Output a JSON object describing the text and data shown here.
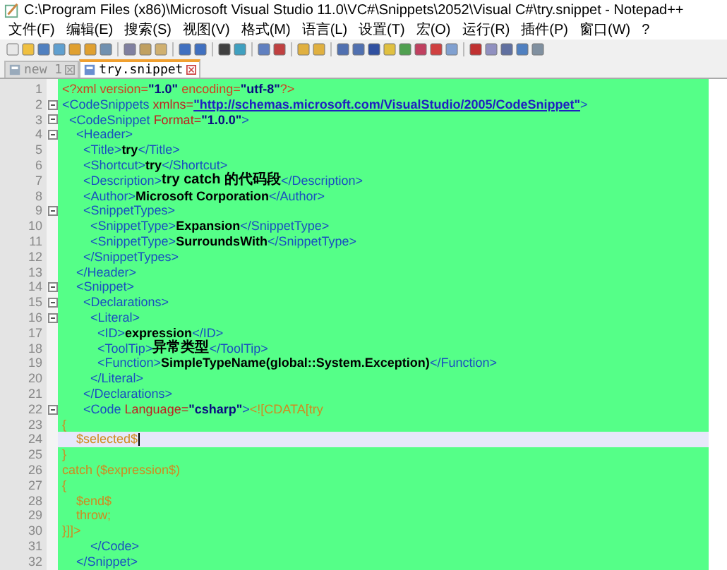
{
  "window": {
    "title": "C:\\Program Files (x86)\\Microsoft Visual Studio 11.0\\VC#\\Snippets\\2052\\Visual C#\\try.snippet - Notepad++"
  },
  "menu": [
    "文件(F)",
    "编辑(E)",
    "搜索(S)",
    "视图(V)",
    "格式(M)",
    "语言(L)",
    "设置(T)",
    "宏(O)",
    "运行(R)",
    "插件(P)",
    "窗口(W)",
    "?"
  ],
  "tabs": [
    {
      "label": "new 1",
      "selected": false
    },
    {
      "label": "try.snippet",
      "selected": true
    }
  ],
  "lines": [
    {
      "number": "1",
      "fold": false,
      "current": false,
      "tokens": [
        {
          "kind": "pi",
          "text": "<?xml version="
        },
        {
          "kind": "value",
          "text": "\"1.0\""
        },
        {
          "kind": "pi",
          "text": " encoding="
        },
        {
          "kind": "value",
          "text": "\"utf-8\""
        },
        {
          "kind": "pi",
          "text": "?>"
        }
      ]
    },
    {
      "number": "2",
      "fold": true,
      "current": false,
      "tokens": [
        {
          "kind": "tag",
          "text": "<CodeSnippets "
        },
        {
          "kind": "attr",
          "text": "xmlns="
        },
        {
          "kind": "link",
          "text": "\"http://schemas.microsoft.com/VisualStudio/2005/CodeSnippet\""
        },
        {
          "kind": "tag",
          "text": ">"
        }
      ]
    },
    {
      "number": "3",
      "fold": true,
      "current": false,
      "tokens": [
        {
          "kind": "tag",
          "text": "  <CodeSnippet "
        },
        {
          "kind": "attr",
          "text": "Format="
        },
        {
          "kind": "value",
          "text": "\"1.0.0\""
        },
        {
          "kind": "tag",
          "text": ">"
        }
      ]
    },
    {
      "number": "4",
      "fold": true,
      "current": false,
      "tokens": [
        {
          "kind": "tag",
          "text": "    <Header>"
        }
      ]
    },
    {
      "number": "5",
      "fold": false,
      "current": false,
      "tokens": [
        {
          "kind": "tag",
          "text": "      <Title>"
        },
        {
          "kind": "text",
          "text": "try"
        },
        {
          "kind": "tag",
          "text": "</Title>"
        }
      ]
    },
    {
      "number": "6",
      "fold": false,
      "current": false,
      "tokens": [
        {
          "kind": "tag",
          "text": "      <Shortcut>"
        },
        {
          "kind": "text",
          "text": "try"
        },
        {
          "kind": "tag",
          "text": "</Shortcut>"
        }
      ]
    },
    {
      "number": "7",
      "fold": false,
      "current": false,
      "tokens": [
        {
          "kind": "tag",
          "text": "      <Description>"
        },
        {
          "kind": "text",
          "text": "try catch 的代码段"
        },
        {
          "kind": "tag",
          "text": "</Description>"
        }
      ]
    },
    {
      "number": "8",
      "fold": false,
      "current": false,
      "tokens": [
        {
          "kind": "tag",
          "text": "      <Author>"
        },
        {
          "kind": "text",
          "text": "Microsoft Corporation"
        },
        {
          "kind": "tag",
          "text": "</Author>"
        }
      ]
    },
    {
      "number": "9",
      "fold": true,
      "current": false,
      "tokens": [
        {
          "kind": "tag",
          "text": "      <SnippetTypes>"
        }
      ]
    },
    {
      "number": "10",
      "fold": false,
      "current": false,
      "tokens": [
        {
          "kind": "tag",
          "text": "        <SnippetType>"
        },
        {
          "kind": "text",
          "text": "Expansion"
        },
        {
          "kind": "tag",
          "text": "</SnippetType>"
        }
      ]
    },
    {
      "number": "11",
      "fold": false,
      "current": false,
      "tokens": [
        {
          "kind": "tag",
          "text": "        <SnippetType>"
        },
        {
          "kind": "text",
          "text": "SurroundsWith"
        },
        {
          "kind": "tag",
          "text": "</SnippetType>"
        }
      ]
    },
    {
      "number": "12",
      "fold": false,
      "current": false,
      "tokens": [
        {
          "kind": "tag",
          "text": "      </SnippetTypes>"
        }
      ]
    },
    {
      "number": "13",
      "fold": false,
      "current": false,
      "tokens": [
        {
          "kind": "tag",
          "text": "    </Header>"
        }
      ]
    },
    {
      "number": "14",
      "fold": true,
      "current": false,
      "tokens": [
        {
          "kind": "tag",
          "text": "    <Snippet>"
        }
      ]
    },
    {
      "number": "15",
      "fold": true,
      "current": false,
      "tokens": [
        {
          "kind": "tag",
          "text": "      <Declarations>"
        }
      ]
    },
    {
      "number": "16",
      "fold": true,
      "current": false,
      "tokens": [
        {
          "kind": "tag",
          "text": "        <Literal>"
        }
      ]
    },
    {
      "number": "17",
      "fold": false,
      "current": false,
      "tokens": [
        {
          "kind": "tag",
          "text": "          <ID>"
        },
        {
          "kind": "text",
          "text": "expression"
        },
        {
          "kind": "tag",
          "text": "</ID>"
        }
      ]
    },
    {
      "number": "18",
      "fold": false,
      "current": false,
      "tokens": [
        {
          "kind": "tag",
          "text": "          <ToolTip>"
        },
        {
          "kind": "text",
          "text": "异常类型"
        },
        {
          "kind": "tag",
          "text": "</ToolTip>"
        }
      ]
    },
    {
      "number": "19",
      "fold": false,
      "current": false,
      "tokens": [
        {
          "kind": "tag",
          "text": "          <Function>"
        },
        {
          "kind": "text",
          "text": "SimpleTypeName(global::System.Exception)"
        },
        {
          "kind": "tag",
          "text": "</Function>"
        }
      ]
    },
    {
      "number": "20",
      "fold": false,
      "current": false,
      "tokens": [
        {
          "kind": "tag",
          "text": "        </Literal>"
        }
      ]
    },
    {
      "number": "21",
      "fold": false,
      "current": false,
      "tokens": [
        {
          "kind": "tag",
          "text": "      </Declarations>"
        }
      ]
    },
    {
      "number": "22",
      "fold": true,
      "current": false,
      "tokens": [
        {
          "kind": "tag",
          "text": "      <Code "
        },
        {
          "kind": "attr",
          "text": "Language="
        },
        {
          "kind": "value",
          "text": "\"csharp\""
        },
        {
          "kind": "tag",
          "text": ">"
        },
        {
          "kind": "cdata",
          "text": "<![CDATA[try"
        }
      ]
    },
    {
      "number": "23",
      "fold": false,
      "current": false,
      "tokens": [
        {
          "kind": "cdata",
          "text": "{"
        }
      ]
    },
    {
      "number": "24",
      "fold": false,
      "current": true,
      "tokens": [
        {
          "kind": "cdata",
          "text": "    $selected$"
        }
      ]
    },
    {
      "number": "25",
      "fold": false,
      "current": false,
      "tokens": [
        {
          "kind": "cdata",
          "text": "}"
        }
      ]
    },
    {
      "number": "26",
      "fold": false,
      "current": false,
      "tokens": [
        {
          "kind": "cdata",
          "text": "catch ($expression$)"
        }
      ]
    },
    {
      "number": "27",
      "fold": false,
      "current": false,
      "tokens": [
        {
          "kind": "cdata",
          "text": "{"
        }
      ]
    },
    {
      "number": "28",
      "fold": false,
      "current": false,
      "tokens": [
        {
          "kind": "cdata",
          "text": "    $end$"
        }
      ]
    },
    {
      "number": "29",
      "fold": false,
      "current": false,
      "tokens": [
        {
          "kind": "cdata",
          "text": "    throw;"
        }
      ]
    },
    {
      "number": "30",
      "fold": false,
      "current": false,
      "tokens": [
        {
          "kind": "cdata",
          "text": "}]]>"
        }
      ]
    },
    {
      "number": "31",
      "fold": false,
      "current": false,
      "tokens": [
        {
          "kind": "tag",
          "text": "        </Code>"
        }
      ]
    },
    {
      "number": "32",
      "fold": false,
      "current": false,
      "tokens": [
        {
          "kind": "tag",
          "text": "    </Snippet>"
        }
      ]
    }
  ]
}
